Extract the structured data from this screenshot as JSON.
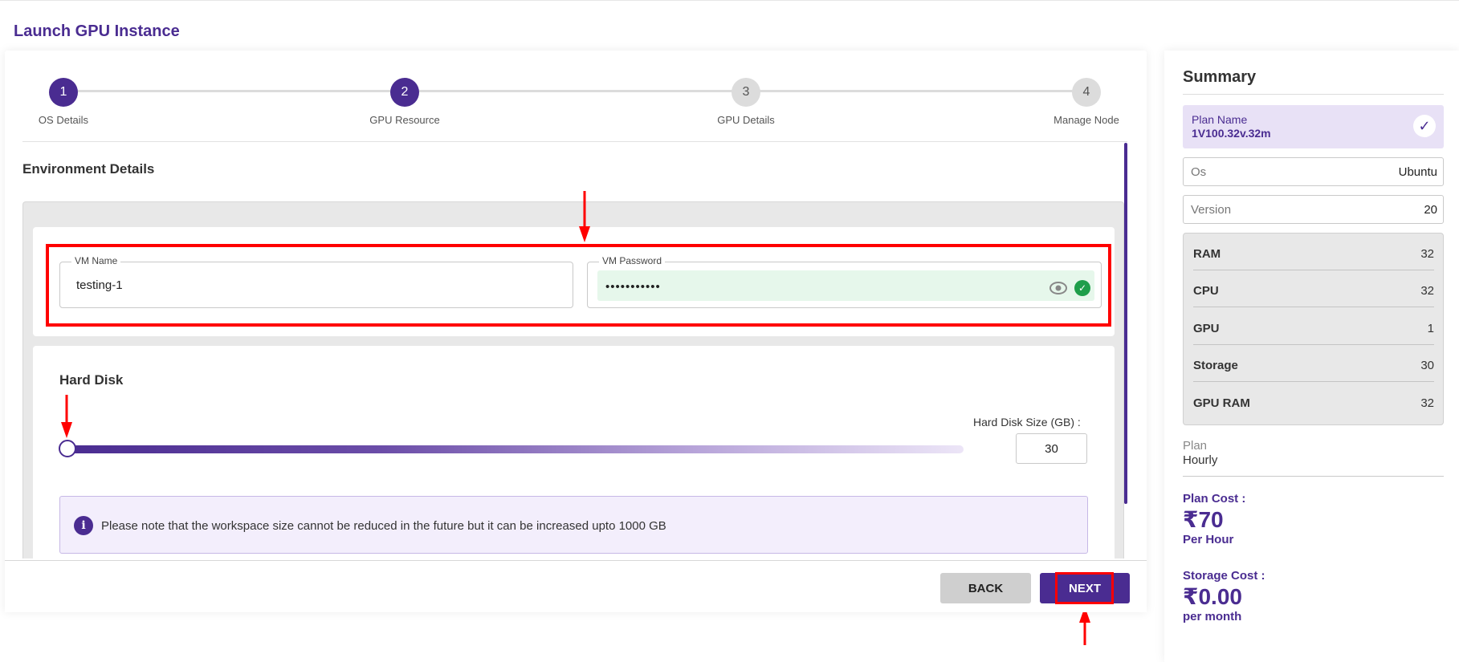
{
  "page_title": "Launch GPU Instance",
  "stepper": {
    "steps": [
      {
        "number": "1",
        "label": "OS Details"
      },
      {
        "number": "2",
        "label": "GPU Resource"
      },
      {
        "number": "3",
        "label": "GPU Details"
      },
      {
        "number": "4",
        "label": "Manage Node"
      }
    ]
  },
  "environment": {
    "title": "Environment Details",
    "vm_name_label": "VM Name",
    "vm_name_value": "testing-1",
    "vm_password_label": "VM Password",
    "vm_password_value": "•••••••••••"
  },
  "hard_disk": {
    "title": "Hard Disk",
    "size_label": "Hard Disk Size (GB) :",
    "size_value": "30",
    "slider_level_fraction": 0.0,
    "note": "Please note that the workspace size cannot be reduced in the future but it can be increased upto 1000 GB"
  },
  "footer": {
    "back_label": "BACK",
    "next_label": "NEXT"
  },
  "summary": {
    "title": "Summary",
    "plan_name_label": "Plan Name",
    "plan_name_value": "1V100.32v.32m",
    "os_label": "Os",
    "os_value": "Ubuntu",
    "version_label": "Version",
    "version_value": "20",
    "specs": [
      {
        "key": "RAM",
        "value": "32"
      },
      {
        "key": "CPU",
        "value": "32"
      },
      {
        "key": "GPU",
        "value": "1"
      },
      {
        "key": "Storage",
        "value": "30"
      },
      {
        "key": "GPU RAM",
        "value": "32"
      }
    ],
    "plan_label": "Plan",
    "plan_value": "Hourly",
    "plan_cost_label": "Plan Cost :",
    "plan_cost_value": "₹70",
    "plan_cost_unit": "Per Hour",
    "storage_cost_label": "Storage Cost :",
    "storage_cost_value": "₹0.00",
    "storage_cost_unit": "per month"
  },
  "colors": {
    "brand": "#4a2c91",
    "annotation_red": "#ff0000",
    "success_green": "#1e9e4a"
  }
}
